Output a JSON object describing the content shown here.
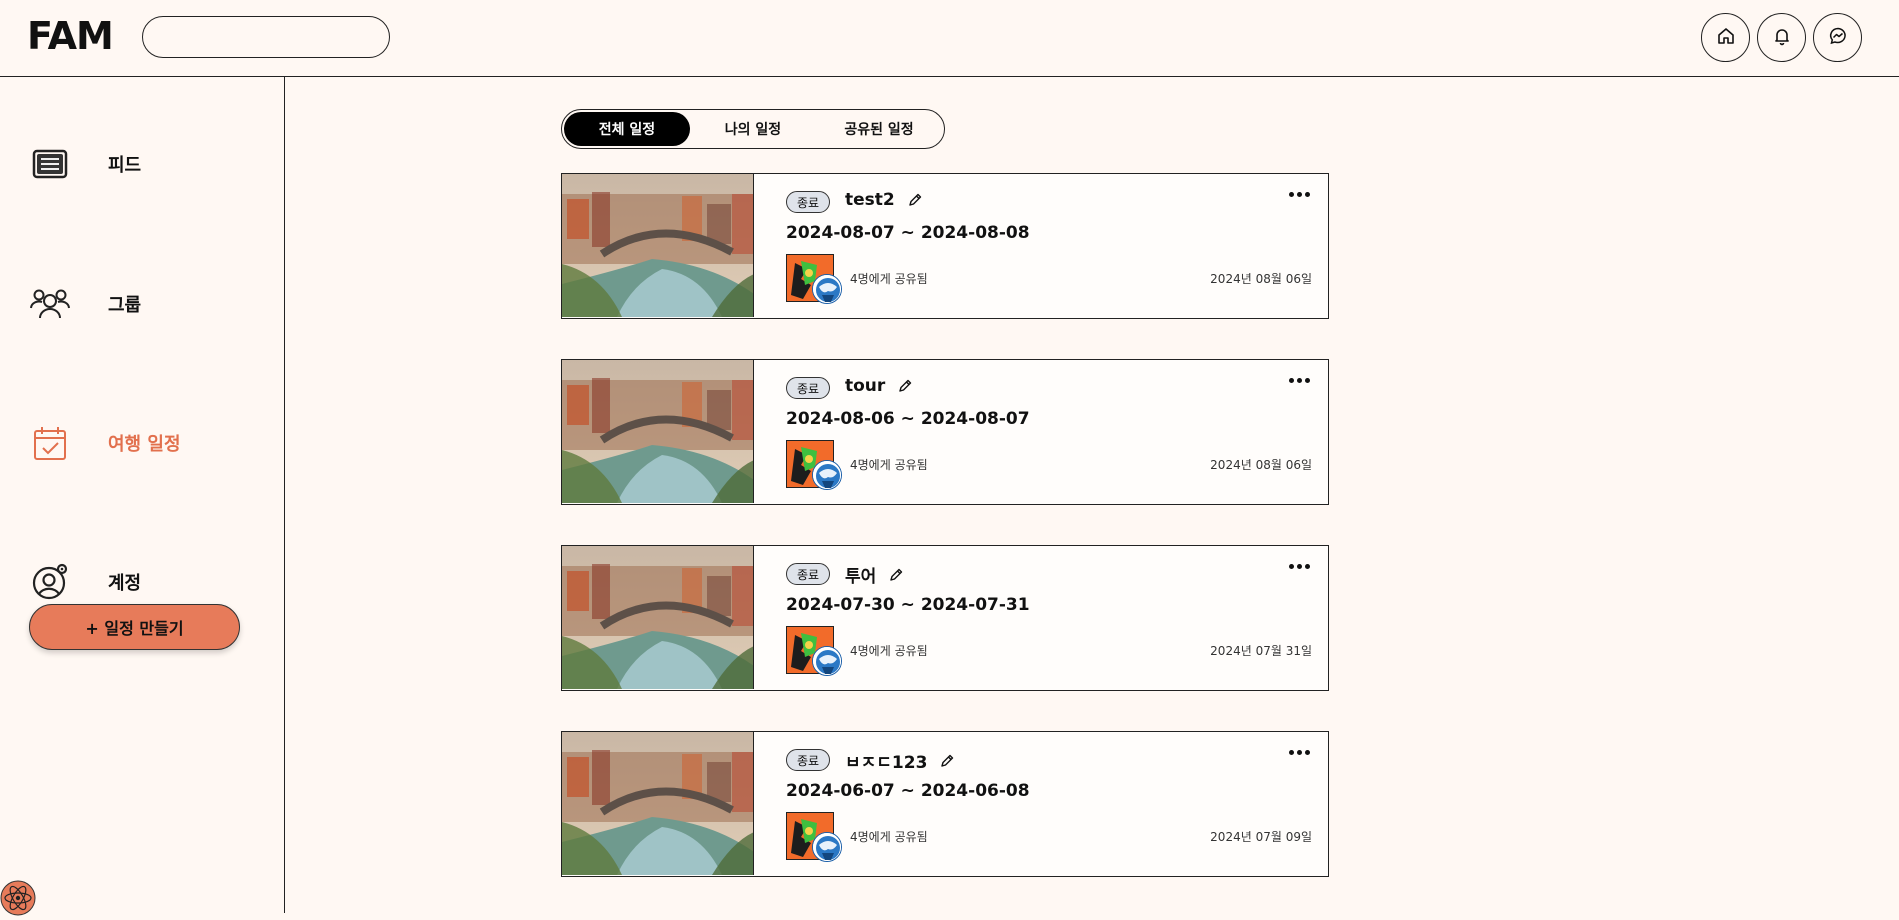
{
  "header": {
    "logo": "FAM",
    "search": {
      "value": "",
      "placeholder": ""
    },
    "icons": [
      "home-icon",
      "bell-icon",
      "messenger-icon"
    ]
  },
  "sidebar": {
    "items": [
      {
        "label": "피드",
        "icon": "feed-icon",
        "active": false
      },
      {
        "label": "그룹",
        "icon": "group-icon",
        "active": false
      },
      {
        "label": "여행 일정",
        "icon": "calendar-check-icon",
        "active": true
      },
      {
        "label": "계정",
        "icon": "account-settings-icon",
        "active": false
      }
    ],
    "create_button": "+ 일정 만들기"
  },
  "tabs": [
    {
      "label": "전체 일정",
      "active": true
    },
    {
      "label": "나의 일정",
      "active": false
    },
    {
      "label": "공유된 일정",
      "active": false
    }
  ],
  "trips": [
    {
      "status": "종료",
      "title": "test2",
      "dates": "2024-08-07 ~ 2024-08-08",
      "shared": "4명에게 공유됨",
      "created": "2024년 08월 06일"
    },
    {
      "status": "종료",
      "title": "tour",
      "dates": "2024-08-06 ~ 2024-08-07",
      "shared": "4명에게 공유됨",
      "created": "2024년 08월 06일"
    },
    {
      "status": "종료",
      "title": "투어",
      "dates": "2024-07-30 ~ 2024-07-31",
      "shared": "4명에게 공유됨",
      "created": "2024년 07월 31일"
    },
    {
      "status": "종료",
      "title": "ㅂㅈㄷ123",
      "dates": "2024-06-07 ~ 2024-06-08",
      "shared": "4명에게 공유됨",
      "created": "2024년 07월 09일"
    }
  ],
  "colors": {
    "accent": "#e2704d",
    "button": "#e77b5a",
    "background": "#fff8f3"
  }
}
